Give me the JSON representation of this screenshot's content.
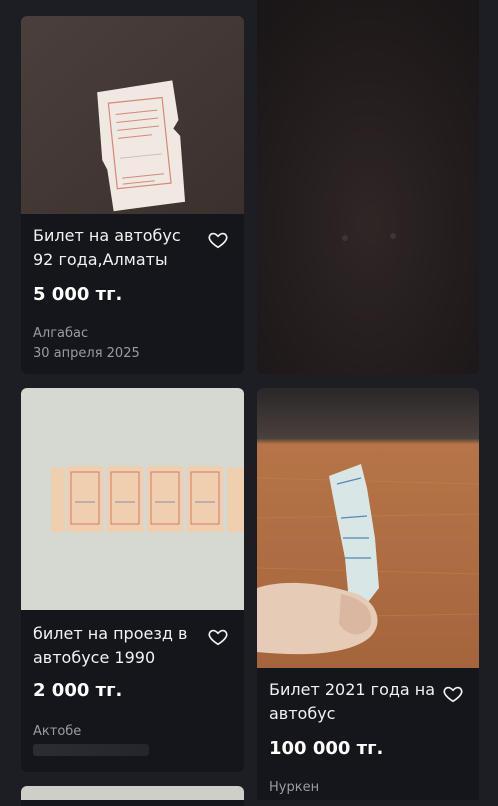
{
  "listings": [
    {
      "title": "Билет на автобус 92 года,Алматы",
      "price": "5 000 тг.",
      "location": "Алгабас",
      "date": "30 апреля 2025",
      "image_icon": "ticket-photo-icon"
    },
    {
      "title": "билет на проезд в автобусе 1990",
      "price": "2 000 тг.",
      "location": "Актобе",
      "date": "",
      "image_icon": "ticket-strip-photo-icon"
    },
    {
      "title": "Билет 2021 года на автобус",
      "price": "100 000 тг.",
      "location": "Нуркен",
      "date": "",
      "image_icon": "hand-ticket-photo-icon"
    }
  ],
  "colors": {
    "page_bg": "#1c1e23",
    "card_bg": "#14161b",
    "muted_text": "#9a9ca1"
  }
}
